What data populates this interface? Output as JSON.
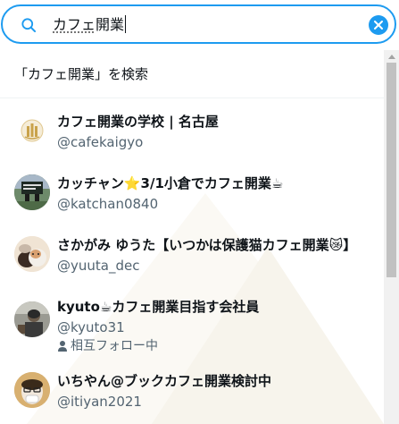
{
  "search": {
    "query_prefix": "カフェ",
    "query_suffix": "開業"
  },
  "search_for": {
    "label": "「カフェ開業」を検索"
  },
  "users": [
    {
      "name": "カフェ開業の学校 | 名古屋",
      "handle": "@cafekaigyo"
    },
    {
      "name": "カッチャン⭐3/1小倉でカフェ開業☕",
      "handle": "@katchan0840"
    },
    {
      "name": "さかがみ ゆうた【いつかは保護猫カフェ開業😿】",
      "handle": "@yuuta_dec"
    },
    {
      "name": "kyuto☕カフェ開業目指す会社員",
      "handle": "@kyuto31",
      "mutual": "相互フォロー中"
    },
    {
      "name": "いちやん@ブックカフェ開業検討中",
      "handle": "@itiyan2021"
    }
  ],
  "colors": {
    "accent": "#1d9bf0",
    "text_primary": "#0f1419",
    "text_secondary": "#536471"
  }
}
